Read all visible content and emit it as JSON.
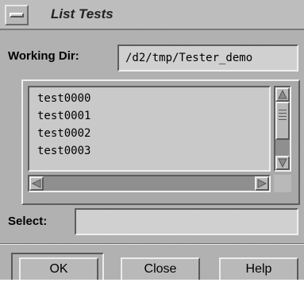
{
  "window": {
    "title": "List Tests"
  },
  "working_dir": {
    "label": "Working Dir:",
    "value": "/d2/tmp/Tester_demo"
  },
  "test_list": {
    "items": [
      "test0000",
      "test0001",
      "test0002",
      "test0003"
    ]
  },
  "select": {
    "label": "Select:",
    "value": ""
  },
  "buttons": {
    "ok": "OK",
    "close": "Close",
    "help": "Help"
  },
  "icons": {
    "window_menu": "window-menu-icon",
    "scroll_up": "arrow-up-icon",
    "scroll_down": "arrow-down-icon",
    "scroll_left": "arrow-left-icon",
    "scroll_right": "arrow-right-icon"
  },
  "colors": {
    "background": "#a9a9a9",
    "field": "#d0d0d0",
    "button": "#b9b9b9"
  }
}
